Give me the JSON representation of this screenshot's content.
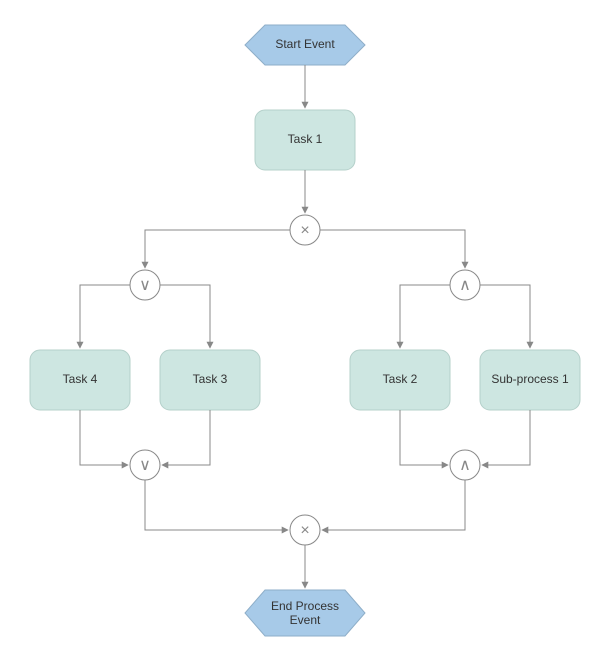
{
  "diagram": {
    "start_event": "Start Event",
    "end_event_l1": "End Process",
    "end_event_l2": "Event",
    "task1": "Task 1",
    "task2": "Task 2",
    "task3": "Task 3",
    "task4": "Task 4",
    "subprocess1": "Sub-process 1",
    "gateway_xor": "×",
    "gateway_or": "∨",
    "gateway_and": "∧"
  }
}
